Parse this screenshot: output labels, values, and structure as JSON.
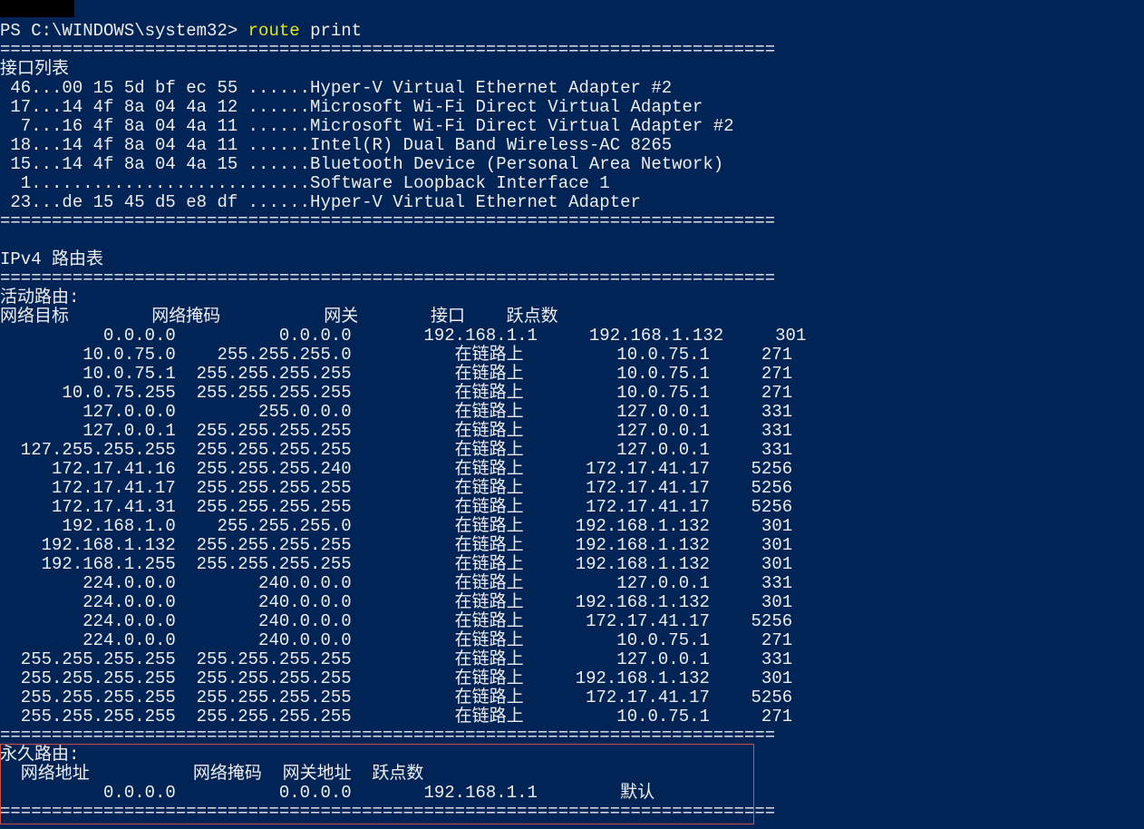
{
  "prompt": {
    "path": "PS C:\\WINDOWS\\system32>",
    "cmd": "route",
    "arg": "print"
  },
  "hr": "===========================================================================",
  "sections": {
    "iface_title": "接口列表",
    "iface_lines": [
      " 46...00 15 5d bf ec 55 ......Hyper-V Virtual Ethernet Adapter #2",
      " 17...14 4f 8a 04 4a 12 ......Microsoft Wi-Fi Direct Virtual Adapter",
      "  7...16 4f 8a 04 4a 11 ......Microsoft Wi-Fi Direct Virtual Adapter #2",
      " 18...14 4f 8a 04 4a 11 ......Intel(R) Dual Band Wireless-AC 8265",
      " 15...14 4f 8a 04 4a 15 ......Bluetooth Device (Personal Area Network)",
      "  1...........................Software Loopback Interface 1",
      " 23...de 15 45 d5 e8 df ......Hyper-V Virtual Ethernet Adapter"
    ],
    "ipv4_title": "IPv4 路由表",
    "active_title": "活动路由:",
    "headers": {
      "dest": "网络目标",
      "mask": "网络掩码",
      "gateway": "网关",
      "iface": "接口",
      "metric": "跃点数"
    },
    "routes": [
      {
        "dest": "0.0.0.0",
        "mask": "0.0.0.0",
        "gateway": "192.168.1.1",
        "iface": "192.168.1.132",
        "metric": "301"
      },
      {
        "dest": "10.0.75.0",
        "mask": "255.255.255.0",
        "gateway": "在链路上",
        "iface": "10.0.75.1",
        "metric": "271"
      },
      {
        "dest": "10.0.75.1",
        "mask": "255.255.255.255",
        "gateway": "在链路上",
        "iface": "10.0.75.1",
        "metric": "271"
      },
      {
        "dest": "10.0.75.255",
        "mask": "255.255.255.255",
        "gateway": "在链路上",
        "iface": "10.0.75.1",
        "metric": "271"
      },
      {
        "dest": "127.0.0.0",
        "mask": "255.0.0.0",
        "gateway": "在链路上",
        "iface": "127.0.0.1",
        "metric": "331"
      },
      {
        "dest": "127.0.0.1",
        "mask": "255.255.255.255",
        "gateway": "在链路上",
        "iface": "127.0.0.1",
        "metric": "331"
      },
      {
        "dest": "127.255.255.255",
        "mask": "255.255.255.255",
        "gateway": "在链路上",
        "iface": "127.0.0.1",
        "metric": "331"
      },
      {
        "dest": "172.17.41.16",
        "mask": "255.255.255.240",
        "gateway": "在链路上",
        "iface": "172.17.41.17",
        "metric": "5256"
      },
      {
        "dest": "172.17.41.17",
        "mask": "255.255.255.255",
        "gateway": "在链路上",
        "iface": "172.17.41.17",
        "metric": "5256"
      },
      {
        "dest": "172.17.41.31",
        "mask": "255.255.255.255",
        "gateway": "在链路上",
        "iface": "172.17.41.17",
        "metric": "5256"
      },
      {
        "dest": "192.168.1.0",
        "mask": "255.255.255.0",
        "gateway": "在链路上",
        "iface": "192.168.1.132",
        "metric": "301"
      },
      {
        "dest": "192.168.1.132",
        "mask": "255.255.255.255",
        "gateway": "在链路上",
        "iface": "192.168.1.132",
        "metric": "301"
      },
      {
        "dest": "192.168.1.255",
        "mask": "255.255.255.255",
        "gateway": "在链路上",
        "iface": "192.168.1.132",
        "metric": "301"
      },
      {
        "dest": "224.0.0.0",
        "mask": "240.0.0.0",
        "gateway": "在链路上",
        "iface": "127.0.0.1",
        "metric": "331"
      },
      {
        "dest": "224.0.0.0",
        "mask": "240.0.0.0",
        "gateway": "在链路上",
        "iface": "192.168.1.132",
        "metric": "301"
      },
      {
        "dest": "224.0.0.0",
        "mask": "240.0.0.0",
        "gateway": "在链路上",
        "iface": "172.17.41.17",
        "metric": "5256"
      },
      {
        "dest": "224.0.0.0",
        "mask": "240.0.0.0",
        "gateway": "在链路上",
        "iface": "10.0.75.1",
        "metric": "271"
      },
      {
        "dest": "255.255.255.255",
        "mask": "255.255.255.255",
        "gateway": "在链路上",
        "iface": "127.0.0.1",
        "metric": "331"
      },
      {
        "dest": "255.255.255.255",
        "mask": "255.255.255.255",
        "gateway": "在链路上",
        "iface": "192.168.1.132",
        "metric": "301"
      },
      {
        "dest": "255.255.255.255",
        "mask": "255.255.255.255",
        "gateway": "在链路上",
        "iface": "172.17.41.17",
        "metric": "5256"
      },
      {
        "dest": "255.255.255.255",
        "mask": "255.255.255.255",
        "gateway": "在链路上",
        "iface": "10.0.75.1",
        "metric": "271"
      }
    ],
    "persist_title": "永久路由:",
    "persist_headers": {
      "addr": "网络地址",
      "mask": "网络掩码",
      "gwaddr": "网关地址",
      "metric": "跃点数"
    },
    "persist_routes": [
      {
        "addr": "0.0.0.0",
        "mask": "0.0.0.0",
        "gwaddr": "192.168.1.1",
        "metric": "默认"
      }
    ]
  }
}
